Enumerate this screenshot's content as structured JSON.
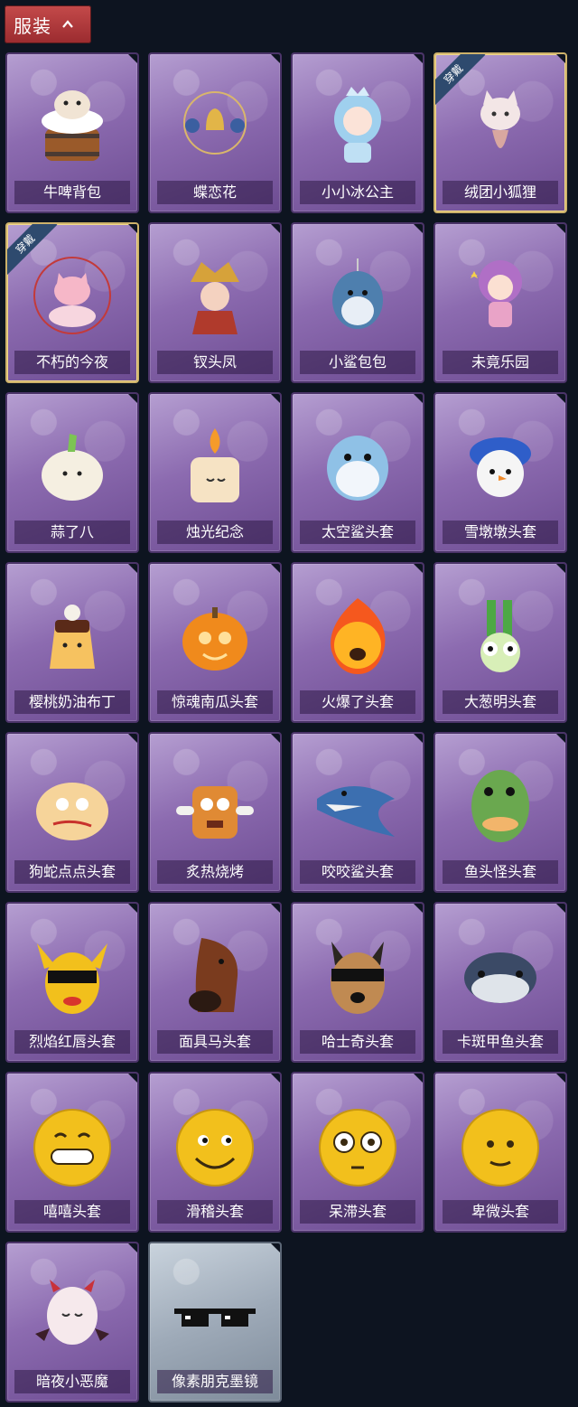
{
  "header": {
    "title": "服装"
  },
  "equipped_badge": "穿戴",
  "items": [
    {
      "name": "牛啤背包",
      "icon": "beer-barrel-cow-icon",
      "equipped": false
    },
    {
      "name": "蝶恋花",
      "icon": "bell-ornament-icon",
      "equipped": false
    },
    {
      "name": "小小冰公主",
      "icon": "ice-princess-icon",
      "equipped": false
    },
    {
      "name": "绒团小狐狸",
      "icon": "fox-plush-icon",
      "equipped": true
    },
    {
      "name": "不朽的今夜",
      "icon": "cat-bowl-icon",
      "equipped": true
    },
    {
      "name": "钗头凤",
      "icon": "phoenix-crown-icon",
      "equipped": false
    },
    {
      "name": "小鲨包包",
      "icon": "shark-bag-icon",
      "equipped": false
    },
    {
      "name": "未竟乐园",
      "icon": "doll-icon",
      "equipped": false
    },
    {
      "name": "蒜了八",
      "icon": "garlic-icon",
      "equipped": false
    },
    {
      "name": "烛光纪念",
      "icon": "candle-icon",
      "equipped": false
    },
    {
      "name": "太空鲨头套",
      "icon": "shark-head-icon",
      "equipped": false
    },
    {
      "name": "雪墩墩头套",
      "icon": "snowman-head-icon",
      "equipped": false
    },
    {
      "name": "樱桃奶油布丁",
      "icon": "pudding-icon",
      "equipped": false
    },
    {
      "name": "惊魂南瓜头套",
      "icon": "pumpkin-icon",
      "equipped": false
    },
    {
      "name": "火爆了头套",
      "icon": "fire-head-icon",
      "equipped": false
    },
    {
      "name": "大葱明头套",
      "icon": "scallion-head-icon",
      "equipped": false
    },
    {
      "name": "狗蛇点点头套",
      "icon": "bun-head-icon",
      "equipped": false
    },
    {
      "name": "炙热烧烤",
      "icon": "barbecue-head-icon",
      "equipped": false
    },
    {
      "name": "咬咬鲨头套",
      "icon": "biting-shark-icon",
      "equipped": false
    },
    {
      "name": "鱼头怪头套",
      "icon": "fish-monster-icon",
      "equipped": false
    },
    {
      "name": "烈焰红唇头套",
      "icon": "yellow-mask-sunglasses-icon",
      "equipped": false
    },
    {
      "name": "面具马头套",
      "icon": "horse-mask-icon",
      "equipped": false
    },
    {
      "name": "哈士奇头套",
      "icon": "husky-sunglasses-icon",
      "equipped": false
    },
    {
      "name": "卡斑甲鱼头套",
      "icon": "fish-head-icon",
      "equipped": false
    },
    {
      "name": "嘻嘻头套",
      "icon": "grin-emoji-icon",
      "equipped": false
    },
    {
      "name": "滑稽头套",
      "icon": "smirk-emoji-icon",
      "equipped": false
    },
    {
      "name": "呆滞头套",
      "icon": "dazed-emoji-icon",
      "equipped": false
    },
    {
      "name": "卑微头套",
      "icon": "humble-emoji-icon",
      "equipped": false
    },
    {
      "name": "暗夜小恶魔",
      "icon": "little-devil-icon",
      "equipped": false
    },
    {
      "name": "像素朋克墨镜",
      "icon": "pixel-sunglasses-icon",
      "equipped": false,
      "rarity": "common"
    }
  ]
}
